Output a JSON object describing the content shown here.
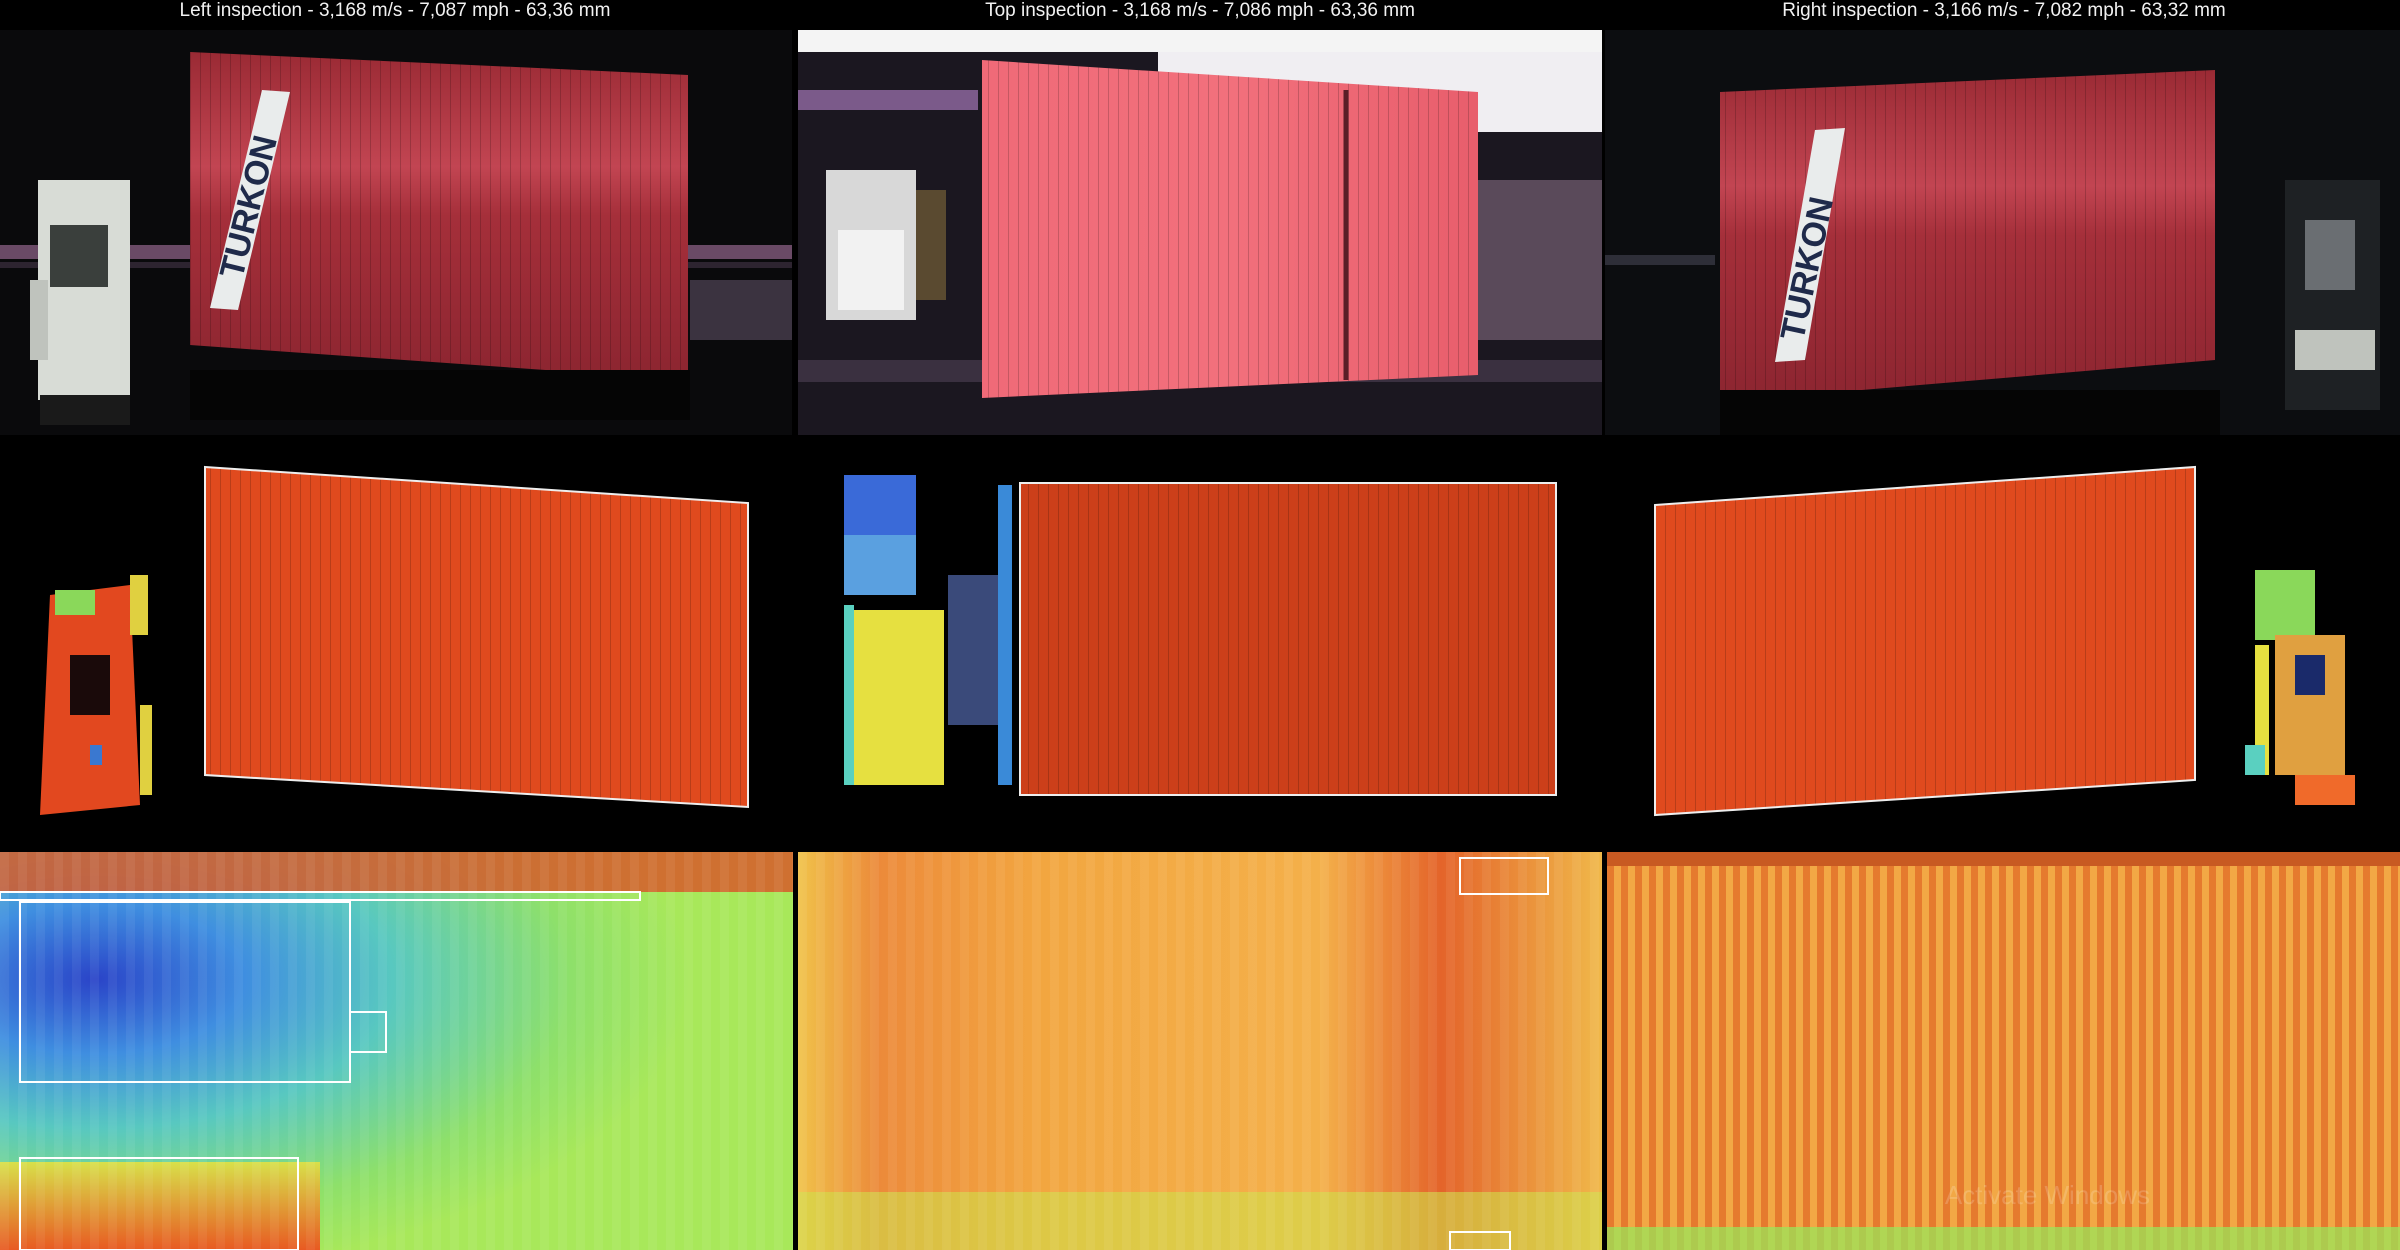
{
  "headers": {
    "left": "Left inspection - 3,168 m/s - 7,087 mph - 63,36 mm",
    "top": "Top inspection - 3,168 m/s - 7,086 mph - 63,36 mm",
    "right": "Right inspection - 3,166 m/s - 7,082 mph - 63,32 mm"
  },
  "container_brand": "TURKON",
  "watermark": "Activate Windows",
  "colors": {
    "container_red": "#b8333f",
    "container_pink": "#f06a78",
    "depth_red": "#e2481f",
    "heat_green": "#9ae65a",
    "heat_orange": "#f29a3a",
    "heat_blue": "#2a60e0"
  }
}
